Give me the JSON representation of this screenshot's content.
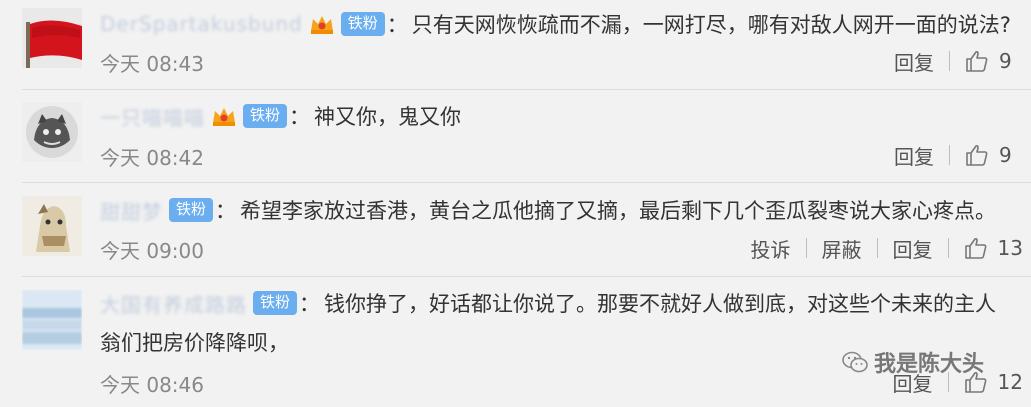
{
  "comments": [
    {
      "username": "DerSpartakusbund",
      "badge": "铁粉",
      "colon": "：",
      "text": "只有天网恢恢疏而不漏，一网打尽，哪有对敌人网开一面的说法?",
      "text_line2": "",
      "time": "今天 08:43",
      "report": "",
      "block": "",
      "reply": "回复",
      "likes": "9"
    },
    {
      "username": "一只喵喵喵",
      "badge": "铁粉",
      "colon": "：",
      "text": "神又你，鬼又你",
      "text_line2": "",
      "time": "今天 08:42",
      "report": "",
      "block": "",
      "reply": "回复",
      "likes": "9"
    },
    {
      "username": "甜甜梦",
      "badge": "铁粉",
      "colon": "：",
      "text": "希望李家放过香港，黄台之瓜他摘了又摘，最后剩下几个歪瓜裂枣说大家心疼点。",
      "text_line2": "",
      "time": "今天 09:00",
      "report": "投诉",
      "block": "屏蔽",
      "reply": "回复",
      "likes": "13"
    },
    {
      "username": "大国有养成路路",
      "badge": "铁粉",
      "colon": "：",
      "text": "钱你挣了，好话都让你说了。那要不就好人做到底，对这些个未来的主人",
      "text_line2": "翁们把房价降降呗，",
      "time": "今天 08:46",
      "report": "",
      "block": "",
      "reply": "回复",
      "likes": "12"
    }
  ],
  "watermark": {
    "text": "我是陈大头",
    "icon": "wechat-icon"
  },
  "colors": {
    "background": "#f2f2f2",
    "badge": "#6aaef0",
    "text": "#333333",
    "muted": "#888888"
  }
}
